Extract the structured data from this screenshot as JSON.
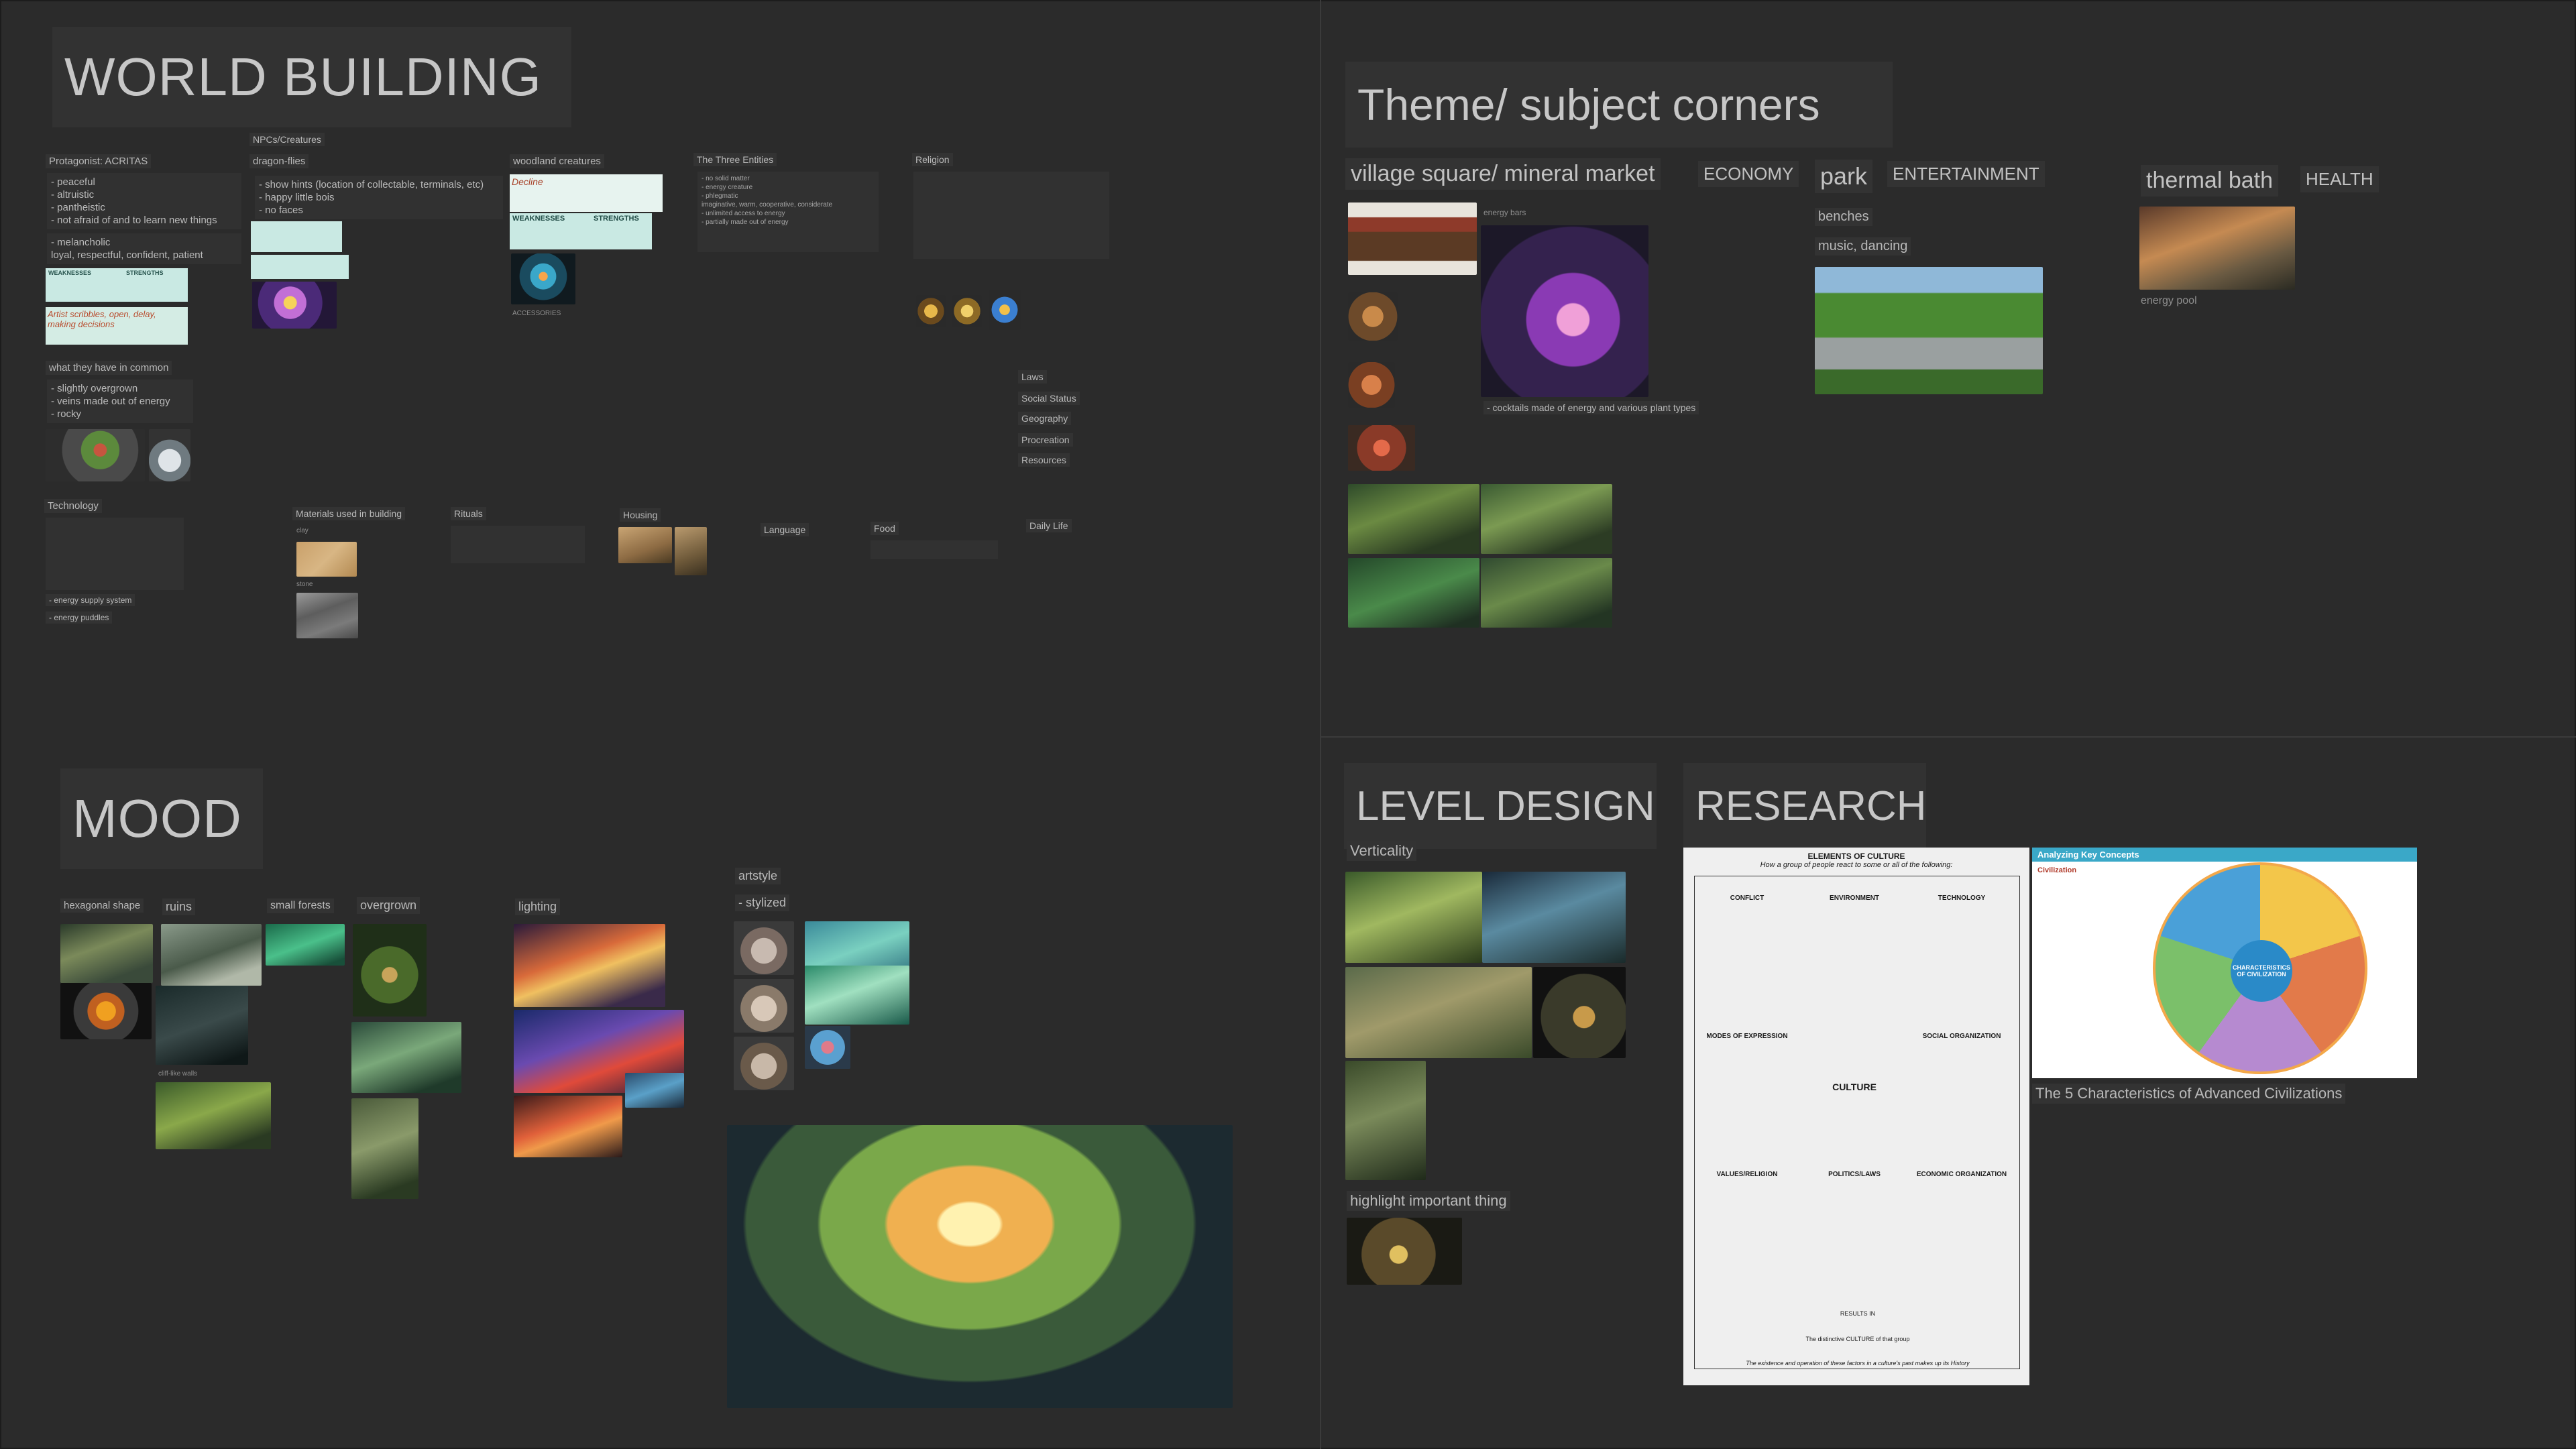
{
  "world_building": {
    "title": "WORLD BUILDING",
    "protagonist": {
      "heading": "Protagonist: ACRITAS",
      "traits": [
        "- peaceful",
        "- altruistic",
        "- pantheistic",
        "- not afraid of and to learn new things"
      ],
      "traits2": [
        "- melancholic",
        "  loyal, respectful, confident, patient"
      ],
      "card_weak": "WEAKNESSES",
      "card_strong": "STRENGTHS",
      "card2_text": "Artist  scribbles, open, delay, making decisions"
    },
    "npcs": {
      "heading": "NPCs/Creatures",
      "sub": "dragon-flies",
      "traits": [
        "- show hints (location of collectable, terminals, etc)",
        "- happy little bois",
        "- no faces"
      ]
    },
    "woodland": {
      "heading": "woodland creatures",
      "card_text": "Decline",
      "weak": "WEAKNESSES",
      "strong": "STRENGTHS",
      "caption": "ACCESSORIES"
    },
    "three_entities": {
      "heading": "The Three Entities",
      "lines": [
        "- no solid matter",
        "- energy creature",
        "- phlegmatic",
        "  imaginative, warm, cooperative, considerate",
        "- unlimited access to energy",
        "- partially made out of energy"
      ]
    },
    "religion": {
      "heading": "Religion"
    },
    "common": {
      "heading": "what they have in common",
      "lines": [
        "- slightly overgrown",
        "- veins made out of energy",
        "- rocky"
      ]
    },
    "world_topics": [
      "Laws",
      "Social Status",
      "Geography",
      "Procreation",
      "Resources"
    ],
    "technology": {
      "heading": "Technology",
      "lines": [
        "- energy supply system",
        "- energy puddles"
      ]
    },
    "materials": {
      "heading": "Materials used in building",
      "cap1": "clay",
      "cap2": "stone"
    },
    "rituals": "Rituals",
    "housing": "Housing",
    "language": "Language",
    "food": "Food",
    "daily_life": "Daily Life"
  },
  "theme": {
    "title": "Theme/ subject corners",
    "village": "village square/ mineral market",
    "economy": "ECONOMY",
    "energy_bars": "energy bars",
    "cocktails": "- cocktails made of energy and various plant types",
    "park": "park",
    "entertainment": "ENTERTAINMENT",
    "benches": "benches",
    "music": "music, dancing",
    "thermal": "thermal bath",
    "health": "HEALTH",
    "energy_pool": "energy pool"
  },
  "mood": {
    "title": "MOOD",
    "hexagonal": "hexagonal shape",
    "ruins": "ruins",
    "small_forests": "small forests",
    "overgrown": "overgrown",
    "cliff_like": "cliff-like walls",
    "lighting": "lighting",
    "artstyle": "artstyle",
    "stylized": "- stylized"
  },
  "level_design": {
    "title": "LEVEL DESIGN",
    "verticality": "Verticality",
    "highlight": "highlight important thing"
  },
  "research": {
    "title": "RESEARCH",
    "doc_title": "ELEMENTS OF CULTURE",
    "doc_subtitle": "How a group of people react to some or all of the following:",
    "conflict": "CONFLICT",
    "environment": "ENVIRONMENT",
    "technology": "TECHNOLOGY",
    "modes": "MODES OF EXPRESSION",
    "social": "SOCIAL ORGANIZATION",
    "culture": "CULTURE",
    "values": "VALUES/RELIGION",
    "politics": "POLITICS/LAWS",
    "economic": "ECONOMIC ORGANIZATION",
    "results": "RESULTS    IN",
    "distinctive": "The distinctive CULTURE of that group",
    "footer": "The existence and operation of these factors in a culture's past makes up its History",
    "key_concepts": "Analyzing Key Concepts",
    "civilization": "Civilization",
    "center": "CHARACTERISTICS OF CIVILIZATION",
    "caption": "The 5 Characteristics of Advanced Civilizations"
  }
}
